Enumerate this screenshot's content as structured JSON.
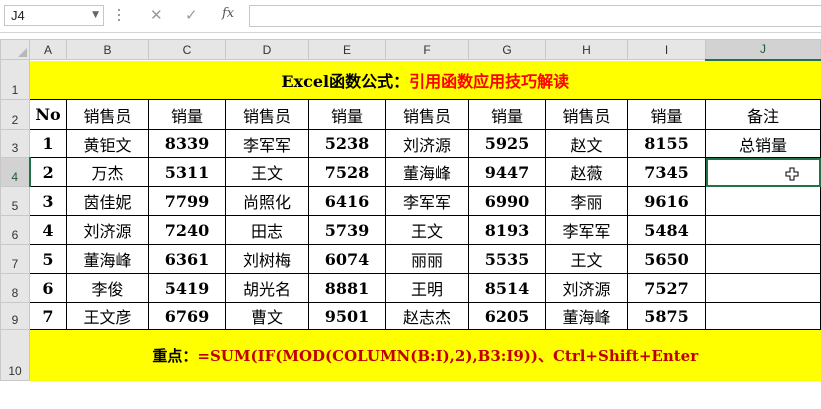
{
  "formula_bar": {
    "name_box": "J4",
    "cancel_glyph": "✕",
    "enter_glyph": "✓",
    "fx_label": "fx",
    "formula": ""
  },
  "columns": [
    "A",
    "B",
    "C",
    "D",
    "E",
    "F",
    "G",
    "H",
    "I",
    "J"
  ],
  "rows": [
    "1",
    "2",
    "3",
    "4",
    "5",
    "6",
    "7",
    "8",
    "9",
    "10"
  ],
  "selected_cell": {
    "column": "J",
    "row": "4"
  },
  "title": {
    "part1": "Excel函数公式：",
    "part2": "引用函数应用技巧解读"
  },
  "table": {
    "headers": [
      "No",
      "销售员",
      "销量",
      "销售员",
      "销量",
      "销售员",
      "销量",
      "销售员",
      "销量",
      "备注"
    ],
    "rows": [
      [
        "1",
        "黄钜文",
        "8339",
        "李军军",
        "5238",
        "刘济源",
        "5925",
        "赵文",
        "8155",
        "总销量"
      ],
      [
        "2",
        "万杰",
        "5311",
        "王文",
        "7528",
        "董海峰",
        "9447",
        "赵薇",
        "7345",
        ""
      ],
      [
        "3",
        "茵佳妮",
        "7799",
        "尚照化",
        "6416",
        "李军军",
        "6990",
        "李丽",
        "9616",
        ""
      ],
      [
        "4",
        "刘济源",
        "7240",
        "田志",
        "5739",
        "王文",
        "8193",
        "李军军",
        "5484",
        ""
      ],
      [
        "5",
        "董海峰",
        "6361",
        "刘树梅",
        "6074",
        "丽丽",
        "5535",
        "王文",
        "5650",
        ""
      ],
      [
        "6",
        "李俊",
        "5419",
        "胡光名",
        "8881",
        "王明",
        "8514",
        "刘济源",
        "7527",
        ""
      ],
      [
        "7",
        "王文彦",
        "6769",
        "曹文",
        "9501",
        "赵志杰",
        "6205",
        "董海峰",
        "5875",
        ""
      ]
    ]
  },
  "note": {
    "part1": "重点：",
    "part2": "=SUM(IF(MOD(COLUMN(B:I),2),B3:I9))、Ctrl+Shift+Enter"
  },
  "colors": {
    "highlight": "#ffff00",
    "accent_red": "#ff0000",
    "note_red": "#c00000",
    "selection": "#217346"
  },
  "icons": {
    "name_box_dropdown": "chevron-down-icon",
    "cursor": "cell-cross-cursor-icon"
  }
}
